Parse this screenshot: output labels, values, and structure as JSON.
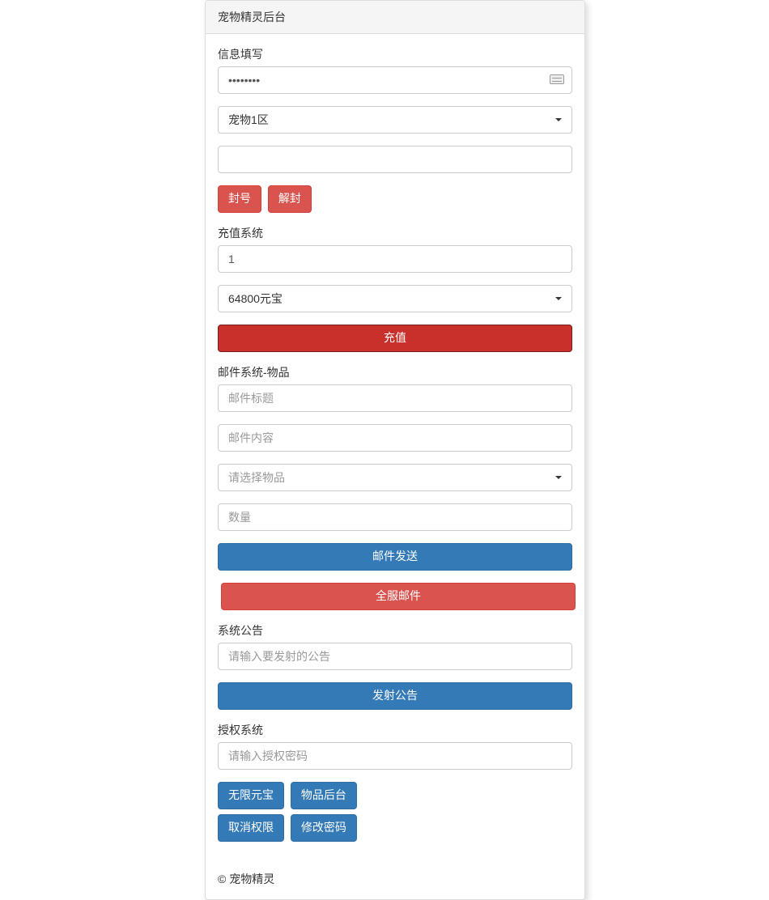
{
  "header": {
    "title": "宠物精灵后台"
  },
  "info": {
    "label": "信息填写",
    "password_value": "••••••••",
    "server_selected": "宠物1区",
    "ban_btn": "封号",
    "unban_btn": "解封"
  },
  "recharge": {
    "label": "充值系统",
    "amount_value": "1",
    "option_selected": "64800元宝",
    "submit_btn": "充值"
  },
  "mail": {
    "label": "邮件系统-物品",
    "title_placeholder": "邮件标题",
    "content_placeholder": "邮件内容",
    "item_placeholder": "请选择物品",
    "qty_placeholder": "数量",
    "send_btn": "邮件发送",
    "broadcast_btn": "全服邮件"
  },
  "announce": {
    "label": "系统公告",
    "placeholder": "请输入要发射的公告",
    "submit_btn": "发射公告"
  },
  "auth": {
    "label": "授权系统",
    "placeholder": "请输入授权密码",
    "b1": "无限元宝",
    "b2": "物品后台",
    "b3": "取消权限",
    "b4": "修改密码"
  },
  "footer": {
    "copyright": "© 宠物精灵"
  }
}
